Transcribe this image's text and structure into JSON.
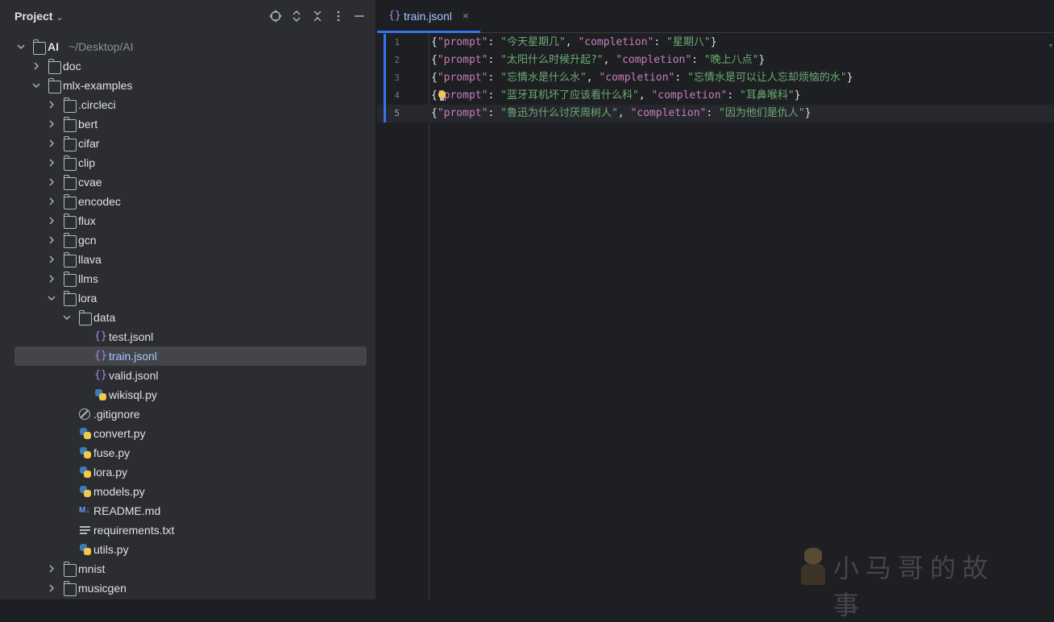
{
  "project": {
    "title": "Project",
    "tree": [
      {
        "label": "AI",
        "sub": "~/Desktop/AI",
        "depth": 0,
        "type": "folder",
        "open": true,
        "bold": true
      },
      {
        "label": "doc",
        "depth": 1,
        "type": "folder",
        "open": false
      },
      {
        "label": "mlx-examples",
        "depth": 1,
        "type": "folder",
        "open": true
      },
      {
        "label": ".circleci",
        "depth": 2,
        "type": "folder",
        "open": false
      },
      {
        "label": "bert",
        "depth": 2,
        "type": "folder",
        "open": false
      },
      {
        "label": "cifar",
        "depth": 2,
        "type": "folder",
        "open": false
      },
      {
        "label": "clip",
        "depth": 2,
        "type": "folder",
        "open": false
      },
      {
        "label": "cvae",
        "depth": 2,
        "type": "folder",
        "open": false
      },
      {
        "label": "encodec",
        "depth": 2,
        "type": "folder",
        "open": false
      },
      {
        "label": "flux",
        "depth": 2,
        "type": "folder",
        "open": false
      },
      {
        "label": "gcn",
        "depth": 2,
        "type": "folder",
        "open": false
      },
      {
        "label": "llava",
        "depth": 2,
        "type": "folder",
        "open": false
      },
      {
        "label": "llms",
        "depth": 2,
        "type": "folder",
        "open": false
      },
      {
        "label": "lora",
        "depth": 2,
        "type": "folder",
        "open": true
      },
      {
        "label": "data",
        "depth": 3,
        "type": "folder",
        "open": true
      },
      {
        "label": "test.jsonl",
        "depth": 4,
        "type": "json"
      },
      {
        "label": "train.jsonl",
        "depth": 4,
        "type": "json",
        "selected": true
      },
      {
        "label": "valid.jsonl",
        "depth": 4,
        "type": "json"
      },
      {
        "label": "wikisql.py",
        "depth": 4,
        "type": "py"
      },
      {
        "label": ".gitignore",
        "depth": 3,
        "type": "ignore"
      },
      {
        "label": "convert.py",
        "depth": 3,
        "type": "py"
      },
      {
        "label": "fuse.py",
        "depth": 3,
        "type": "py"
      },
      {
        "label": "lora.py",
        "depth": 3,
        "type": "py"
      },
      {
        "label": "models.py",
        "depth": 3,
        "type": "py"
      },
      {
        "label": "README.md",
        "depth": 3,
        "type": "md"
      },
      {
        "label": "requirements.txt",
        "depth": 3,
        "type": "txt"
      },
      {
        "label": "utils.py",
        "depth": 3,
        "type": "py"
      },
      {
        "label": "mnist",
        "depth": 2,
        "type": "folder",
        "open": false
      },
      {
        "label": "musicgen",
        "depth": 2,
        "type": "folder",
        "open": false
      }
    ]
  },
  "editor": {
    "tab": {
      "icon": "{}",
      "label": "train.jsonl",
      "close": "×"
    },
    "lines": [
      {
        "num": "1",
        "prompt": "今天星期几",
        "completion": "星期八"
      },
      {
        "num": "2",
        "prompt": "太阳什么时候升起?",
        "completion": "晚上八点"
      },
      {
        "num": "3",
        "prompt": "忘情水是什么水",
        "completion": "忘情水是可以让人忘却烦恼的水"
      },
      {
        "num": "4",
        "prompt": "蓝牙耳机坏了应该看什么科",
        "completion": "耳鼻喉科"
      },
      {
        "num": "5",
        "prompt": "鲁迅为什么讨厌周树人",
        "completion": "因为他们是仇人"
      }
    ],
    "key_prompt": "\"prompt\"",
    "key_completion": "\"completion\"",
    "current_line": 5
  },
  "watermark": {
    "text": "小马哥的故事"
  },
  "colors": {
    "accent": "#3574f0",
    "key": "#c77dbb",
    "string": "#6aab73",
    "selected_text": "#a9c6ff"
  }
}
